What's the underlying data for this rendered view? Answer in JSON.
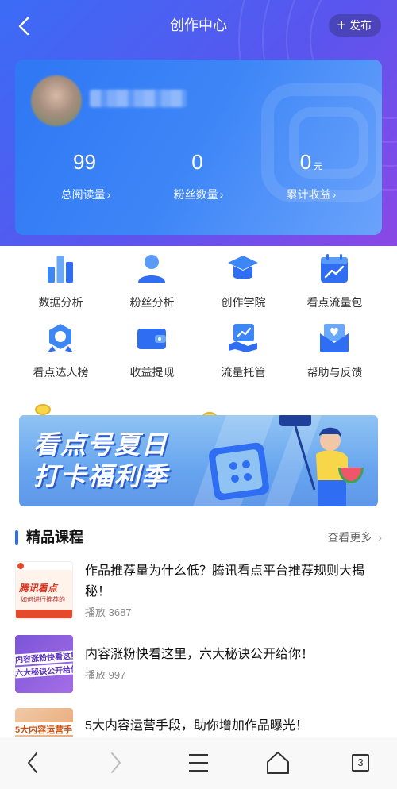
{
  "header": {
    "title": "创作中心",
    "publish_label": "发布"
  },
  "profile": {
    "username": ""
  },
  "stats": [
    {
      "value": "99",
      "unit": "",
      "label": "总阅读量"
    },
    {
      "value": "0",
      "unit": "",
      "label": "粉丝数量"
    },
    {
      "value": "0",
      "unit": "元",
      "label": "累计收益"
    }
  ],
  "tools": [
    {
      "label": "数据分析",
      "icon": "bar-chart-icon"
    },
    {
      "label": "粉丝分析",
      "icon": "user-icon"
    },
    {
      "label": "创作学院",
      "icon": "graduation-cap-icon"
    },
    {
      "label": "看点流量包",
      "icon": "trend-calendar-icon"
    },
    {
      "label": "看点达人榜",
      "icon": "medal-icon"
    },
    {
      "label": "收益提现",
      "icon": "wallet-icon"
    },
    {
      "label": "流量托管",
      "icon": "hand-chart-icon"
    },
    {
      "label": "帮助与反馈",
      "icon": "heart-mail-icon"
    }
  ],
  "banner": {
    "line1": "看点号夏日",
    "line2": "打卡福利季"
  },
  "courses": {
    "section_title": "精品课程",
    "see_more": "查看更多",
    "items": [
      {
        "title": "作品推荐量为什么低？腾讯看点平台推荐规则大揭秘！",
        "play_label": "播放",
        "plays": "3687",
        "thumb_text_1": "腾讯看点",
        "thumb_text_2": "如何进行推荐的"
      },
      {
        "title": "内容涨粉快看这里，六大秘诀公开给你！",
        "play_label": "播放",
        "plays": "997",
        "thumb_text_1": "内容涨粉快看这里",
        "thumb_text_2": "六大秘诀公开给你"
      },
      {
        "title": "5大内容运营手段，助你增加作品曝光！",
        "play_label": "",
        "plays": "",
        "thumb_text_1": "5大内容运营手",
        "thumb_text_2": ""
      }
    ]
  },
  "bottom_nav": {
    "tab_count": "3"
  }
}
